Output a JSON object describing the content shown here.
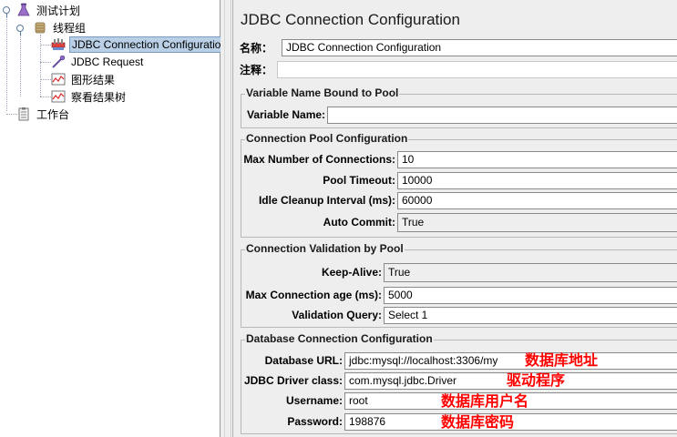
{
  "tree": {
    "test_plan": "测试计划",
    "thread_group": "线程组",
    "items": [
      {
        "label": "JDBC Connection Configuration",
        "icon": "tools-icon"
      },
      {
        "label": "JDBC Request",
        "icon": "pipette-icon"
      },
      {
        "label": "图形结果",
        "icon": "graph-icon"
      },
      {
        "label": "察看结果树",
        "icon": "graph-icon"
      }
    ],
    "workbench": "工作台"
  },
  "panel": {
    "title": "JDBC Connection Configuration",
    "name_label": "名称：",
    "name_value": "JDBC Connection Configuration",
    "comment_label": "注释：",
    "comment_value": "",
    "var_group": {
      "title": "Variable Name Bound to Pool",
      "var_label": "Variable Name:",
      "var_value": ""
    },
    "pool_group": {
      "title": "Connection Pool Configuration",
      "max_conn_label": "Max Number of Connections:",
      "max_conn_value": "10",
      "pool_timeout_label": "Pool Timeout:",
      "pool_timeout_value": "10000",
      "idle_label": "Idle Cleanup Interval (ms):",
      "idle_value": "60000",
      "auto_commit_label": "Auto Commit:",
      "auto_commit_value": "True"
    },
    "validation_group": {
      "title": "Connection Validation by Pool",
      "keepalive_label": "Keep-Alive:",
      "keepalive_value": "True",
      "max_age_label": "Max Connection age (ms):",
      "max_age_value": "5000",
      "query_label": "Validation Query:",
      "query_value": "Select 1"
    },
    "db_group": {
      "title": "Database Connection Configuration",
      "url_label": "Database URL:",
      "url_value": "jdbc:mysql://localhost:3306/my",
      "url_note": "数据库地址",
      "driver_label": "JDBC Driver class:",
      "driver_value": "com.mysql.jdbc.Driver",
      "driver_note": "驱动程序",
      "user_label": "Username:",
      "user_value": "root",
      "user_note": "数据库用户名",
      "pass_label": "Password:",
      "pass_value": "198876",
      "pass_note": "数据库密码"
    }
  },
  "colors": {
    "annotation": "#ff0000",
    "selection": "#b8cfe5",
    "panel_bg": "#eeeeee"
  }
}
